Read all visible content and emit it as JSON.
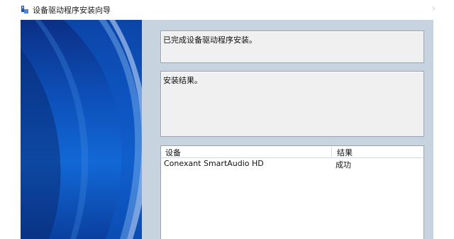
{
  "window": {
    "title": "设备驱动程序安装向导",
    "close_glyph": "›"
  },
  "status": {
    "text": "已完成设备驱动程序安装。"
  },
  "result_box": {
    "text": "安装结果。"
  },
  "device_list": {
    "columns": [
      "设备",
      "结果"
    ],
    "rows": [
      {
        "device": "Conexant SmartAudio HD",
        "result": "成功"
      }
    ]
  },
  "colors": {
    "banner_dark": "#0b2f86",
    "banner_light": "#1268d6",
    "content_bg": "#c8d3e0",
    "field_bg": "#f0f0f0"
  }
}
